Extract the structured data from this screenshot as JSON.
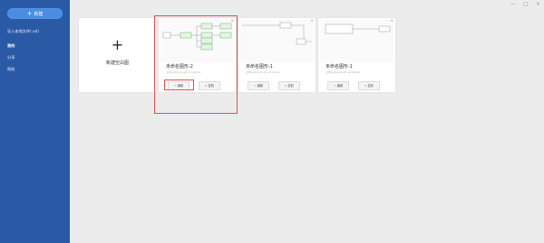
{
  "sidebar": {
    "new_button": "新建",
    "items": [
      {
        "label": "导入本地文件(.xd)"
      },
      {
        "label": "我的"
      },
      {
        "label": "分享"
      },
      {
        "label": "帮助"
      }
    ]
  },
  "window": {
    "minimize": "—",
    "maximize": "□",
    "close": "×"
  },
  "new_card": {
    "plus": "+",
    "label": "新建空白图"
  },
  "cards": [
    {
      "title": "未命名图形-2",
      "date": "上次2019-11-21 17:09:54",
      "edit_label": "编辑",
      "copy_label": "复制",
      "close": "×"
    },
    {
      "title": "未命名图形-1",
      "date": "上次2019-11-21 17:03:21",
      "edit_label": "编辑",
      "copy_label": "复制",
      "close": "×"
    },
    {
      "title": "未命名图形-1",
      "date": "上次2019-11-21 13:28:46",
      "edit_label": "编辑",
      "copy_label": "复制",
      "close": "×"
    }
  ],
  "colors": {
    "sidebar": "#2a5aa6",
    "accent": "#4a8ee2",
    "highlight": "#e35050"
  }
}
